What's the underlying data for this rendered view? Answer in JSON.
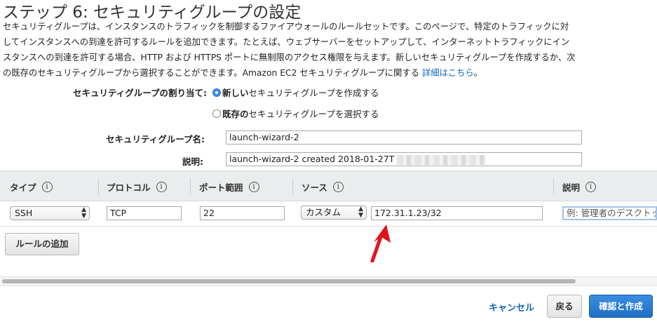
{
  "page": {
    "title": "ステップ 6: セキュリティグループの設定",
    "intro_lines": [
      "セキュリティグループは、インスタンスのトラフィックを制御するファイアウォールのルールセットです。このページで、特定のトラフィックに対",
      "してインスタンスへの到達を許可するルールを追加できます。たとえば、ウェブサーバーをセットアップして、インターネットトラフィックにイン",
      "スタンスへの到達を許可する場合、HTTP および HTTPS ポートに無制限のアクセス権限を与えます。新しいセキュリティグループを作成するか、次",
      "の既存のセキュリティグループから選択することができます。Amazon EC2 セキュリティグループに関する "
    ],
    "intro_link": "詳細はこちら",
    "intro_suffix": "。"
  },
  "assignment": {
    "label": "セキュリティグループの割り当て:",
    "option_new_bold": "新しい",
    "option_new_rest": "セキュリティグループを作成する",
    "option_existing_bold": "既存の",
    "option_existing_rest": "セキュリティグループを選択する",
    "selected": "new"
  },
  "group_name": {
    "label": "セキュリティグループ名:",
    "value": "launch-wizard-2"
  },
  "description": {
    "label": "説明:",
    "value": "launch-wizard-2 created 2018-01-27T"
  },
  "table": {
    "headers": {
      "type": "タイプ",
      "protocol": "プロトコル",
      "port_range": "ポート範囲",
      "source": "ソース",
      "description": "説明"
    },
    "info_icon_glyph": "i",
    "rows": [
      {
        "type": "SSH",
        "protocol": "TCP",
        "port_range": "22",
        "source_select": "カスタム",
        "source_value": "172.31.1.23/32",
        "description_placeholder": "例: 管理者のデスクトップ"
      }
    ]
  },
  "buttons": {
    "add_rule": "ルールの追加",
    "cancel": "キャンセル",
    "back": "戻る",
    "review_launch": "確認と作成"
  },
  "icons": {
    "info": "info-circle-icon",
    "select_arrows": "up-down-arrows-icon",
    "annotation_arrow": "red-arrow-icon"
  },
  "colors": {
    "link": "#1166bb",
    "primary_button": "#2b7dd6",
    "annotation_arrow": "#e3121b",
    "header_bg": "#eaeded"
  }
}
